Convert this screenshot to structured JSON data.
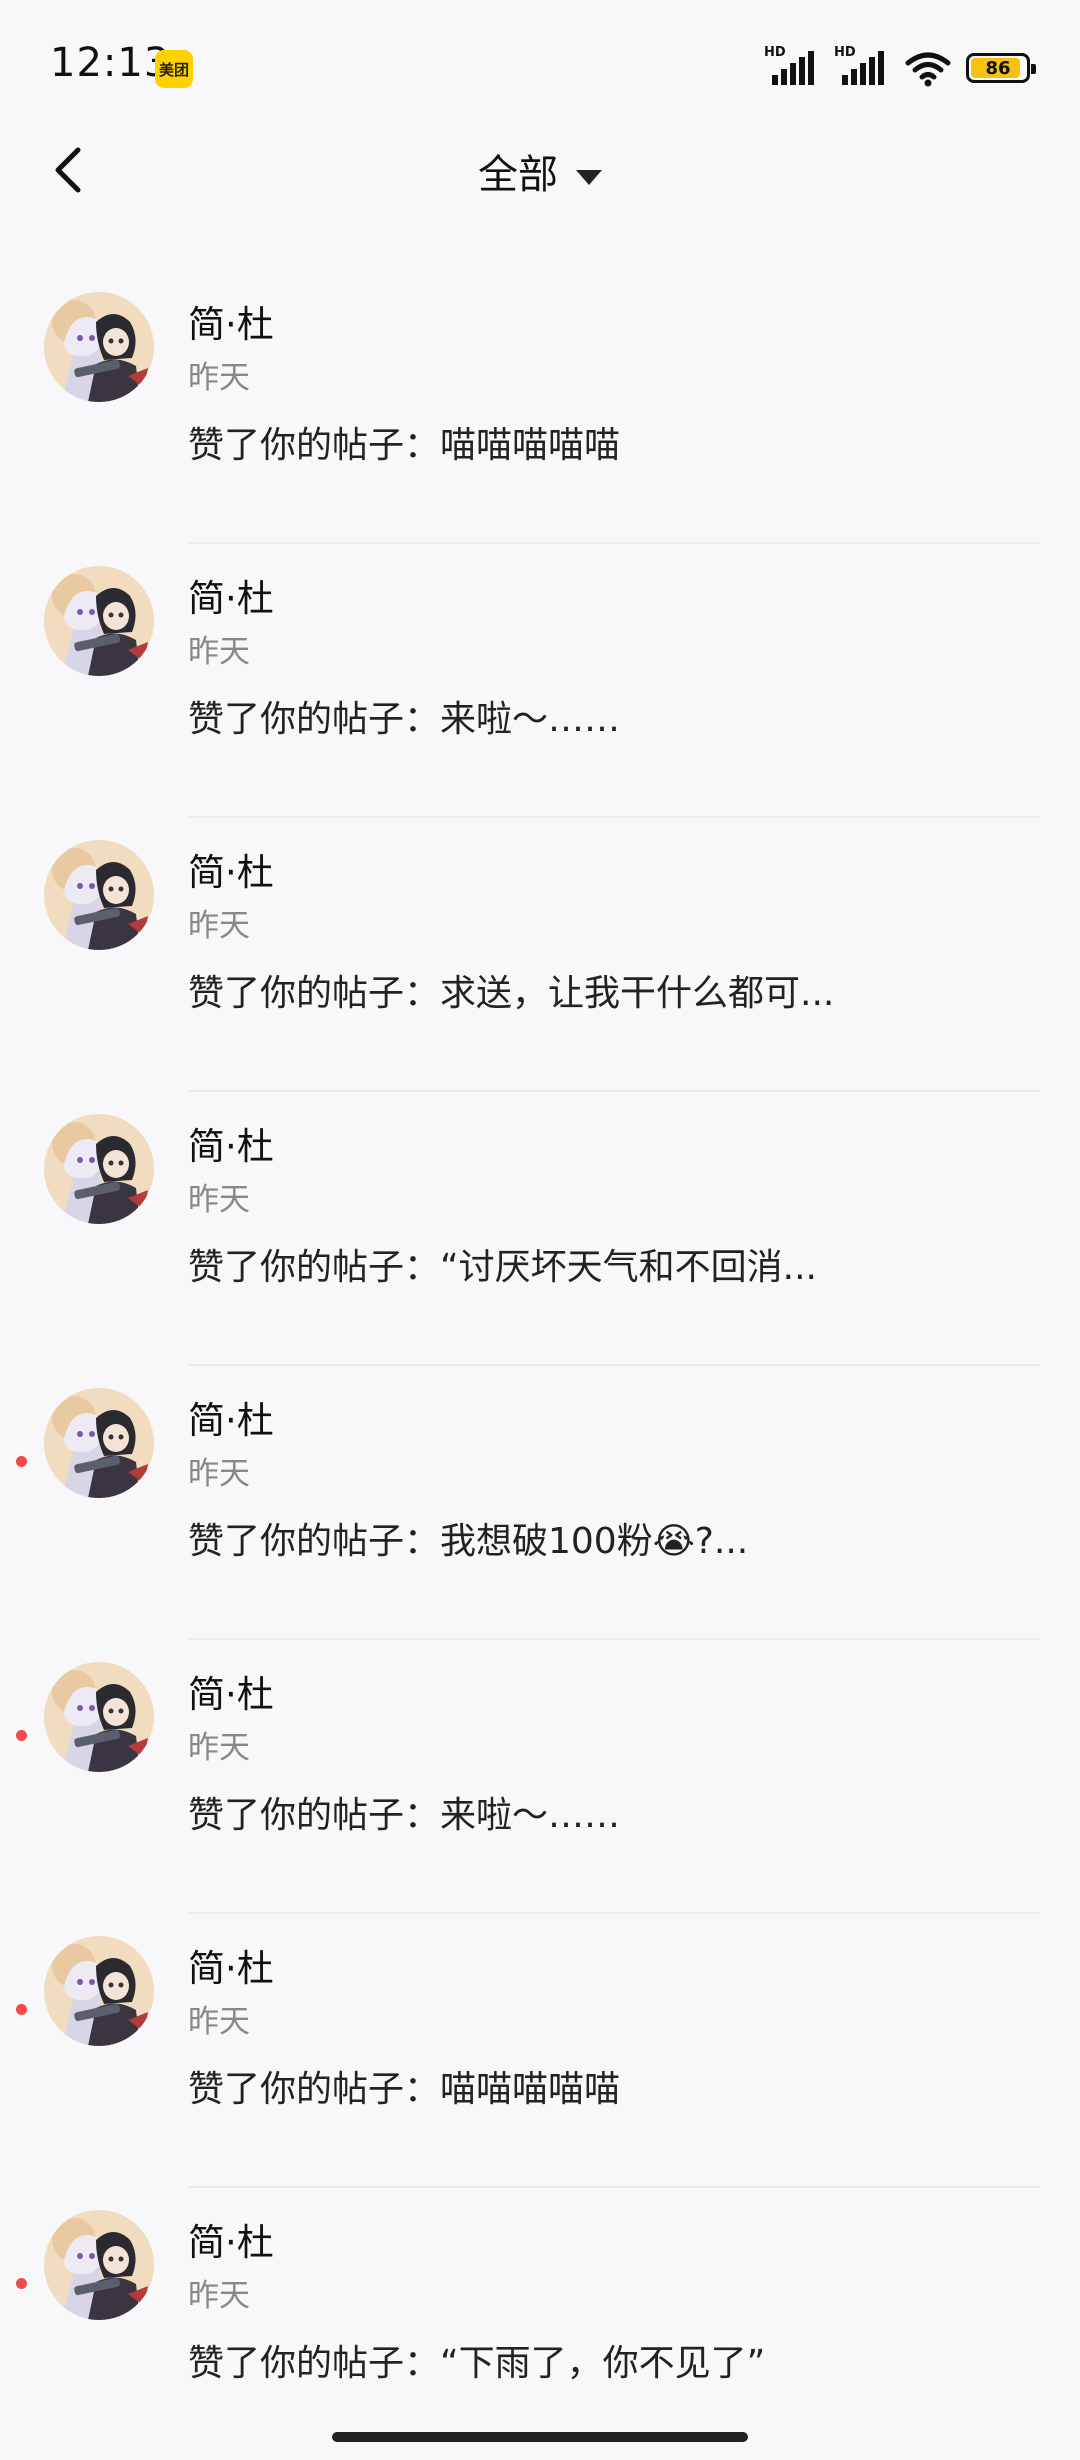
{
  "status_bar": {
    "time": "12:13",
    "app_badge": "美团",
    "battery": "86",
    "signal_label": "HD"
  },
  "nav": {
    "title": "全部",
    "back_icon": "chevron-left-icon",
    "dropdown_icon": "caret-down-icon"
  },
  "notifications": [
    {
      "name": "简·杜",
      "time": "昨天",
      "content": "赞了你的帖子：喵喵喵喵喵",
      "unread": false
    },
    {
      "name": "简·杜",
      "time": "昨天",
      "content": "赞了你的帖子：来啦～……",
      "unread": false
    },
    {
      "name": "简·杜",
      "time": "昨天",
      "content": "赞了你的帖子：求送，让我干什么都可...",
      "unread": false
    },
    {
      "name": "简·杜",
      "time": "昨天",
      "content": "赞了你的帖子：“讨厌坏天气和不回消...",
      "unread": false
    },
    {
      "name": "简·杜",
      "time": "昨天",
      "content": "赞了你的帖子：我想破100粉😭?...",
      "unread": true
    },
    {
      "name": "简·杜",
      "time": "昨天",
      "content": "赞了你的帖子：来啦～……",
      "unread": true
    },
    {
      "name": "简·杜",
      "time": "昨天",
      "content": "赞了你的帖子：喵喵喵喵喵",
      "unread": true
    },
    {
      "name": "简·杜",
      "time": "昨天",
      "content": "赞了你的帖子：“下雨了，你不见了”",
      "unread": true
    }
  ],
  "colors": {
    "unread_dot": "#f04a4a",
    "battery_fill": "#f5c211",
    "app_badge": "#ffd100"
  }
}
